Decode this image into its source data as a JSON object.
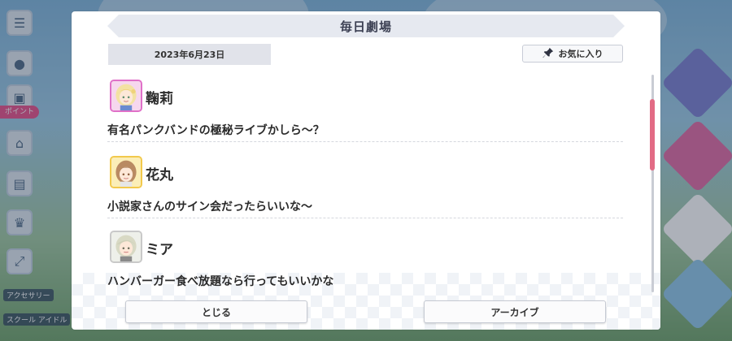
{
  "dialog": {
    "title": "毎日劇場",
    "date": "2023年6月23日",
    "favorite_label": "お気に入り",
    "close_label": "とじる",
    "archive_label": "アーカイブ"
  },
  "entries": [
    {
      "name": "鞠莉",
      "line": "有名パンクバンドの極秘ライブかしら～？",
      "avatar_border": "#e070c8"
    },
    {
      "name": "花丸",
      "line": "小説家さんのサイン会だったらいいな～",
      "avatar_border": "#f2c94c"
    },
    {
      "name": "ミア",
      "line": "ハンバーガー食べ放題なら行ってもいいかな",
      "avatar_border": "#c9c9c9"
    }
  ],
  "background": {
    "left_tag": "ポイント",
    "label_accessory": "アクセサリー",
    "label_school": "スクール アイドル",
    "icons": [
      "menu-icon",
      "chat-icon",
      "gift-icon",
      "monitor-icon",
      "trophy-icon",
      "expand-icon"
    ]
  },
  "colors": {
    "accent": "#e26b85",
    "title_bar": "#e6e9f0"
  }
}
